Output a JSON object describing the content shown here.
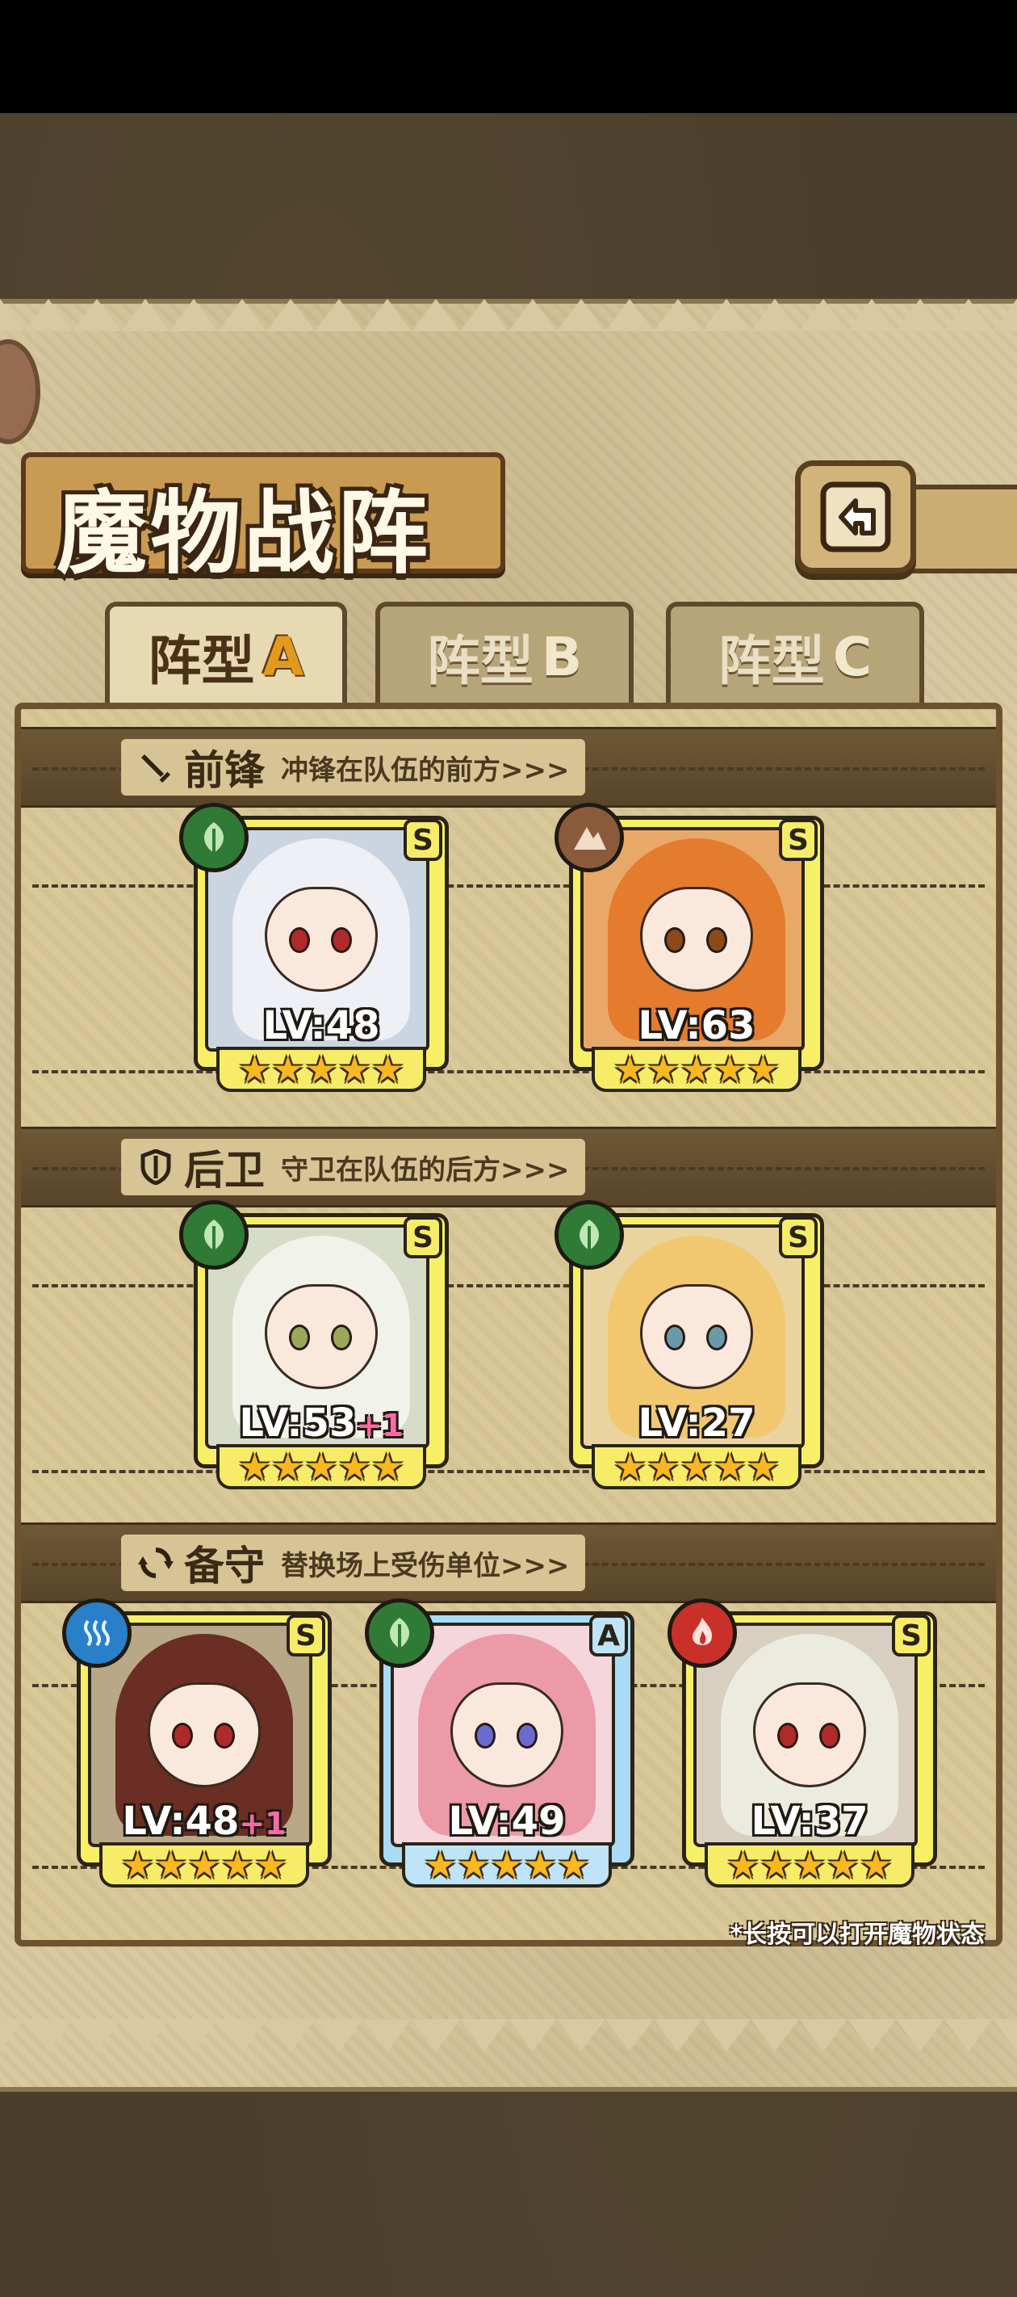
{
  "header": {
    "title": "魔物战阵"
  },
  "tabs": [
    {
      "label": "阵型",
      "suffix": "A",
      "active": true
    },
    {
      "label": "阵型",
      "suffix": "B",
      "active": false
    },
    {
      "label": "阵型",
      "suffix": "C",
      "active": false
    }
  ],
  "sections": {
    "vanguard": {
      "title": "前锋",
      "desc": "冲锋在队伍的前方>>>",
      "icon": "sword-icon"
    },
    "rearguard": {
      "title": "后卫",
      "desc": "守卫在队伍的后方>>>",
      "icon": "shield-icon"
    },
    "reserve": {
      "title": "备守",
      "desc": "替换场上受伤单位>>>",
      "icon": "swap-icon"
    }
  },
  "cards": {
    "v1": {
      "rank": "S",
      "level": "LV:48",
      "plus": "",
      "element": "leaf",
      "stars": "★★★★★"
    },
    "v2": {
      "rank": "S",
      "level": "LV:63",
      "plus": "",
      "element": "earth",
      "stars": "★★★★★"
    },
    "r1": {
      "rank": "S",
      "level": "LV:53",
      "plus": "+1",
      "element": "leaf",
      "stars": "★★★★★"
    },
    "r2": {
      "rank": "S",
      "level": "LV:27",
      "plus": "",
      "element": "leaf",
      "stars": "★★★★★"
    },
    "b1": {
      "rank": "S",
      "level": "LV:48",
      "plus": "+1",
      "element": "water",
      "stars": "★★★★★"
    },
    "b2": {
      "rank": "A",
      "level": "LV:49",
      "plus": "",
      "element": "leaf",
      "stars": "★★★★★"
    },
    "b3": {
      "rank": "S",
      "level": "LV:37",
      "plus": "",
      "element": "fire",
      "stars": "★★★★★"
    }
  },
  "hint": "*长按可以打开魔物状态",
  "colors": {
    "leaf": "#2f7a35",
    "earth": "#8a5a3a",
    "water": "#2a7fc9",
    "fire": "#c9302a"
  }
}
